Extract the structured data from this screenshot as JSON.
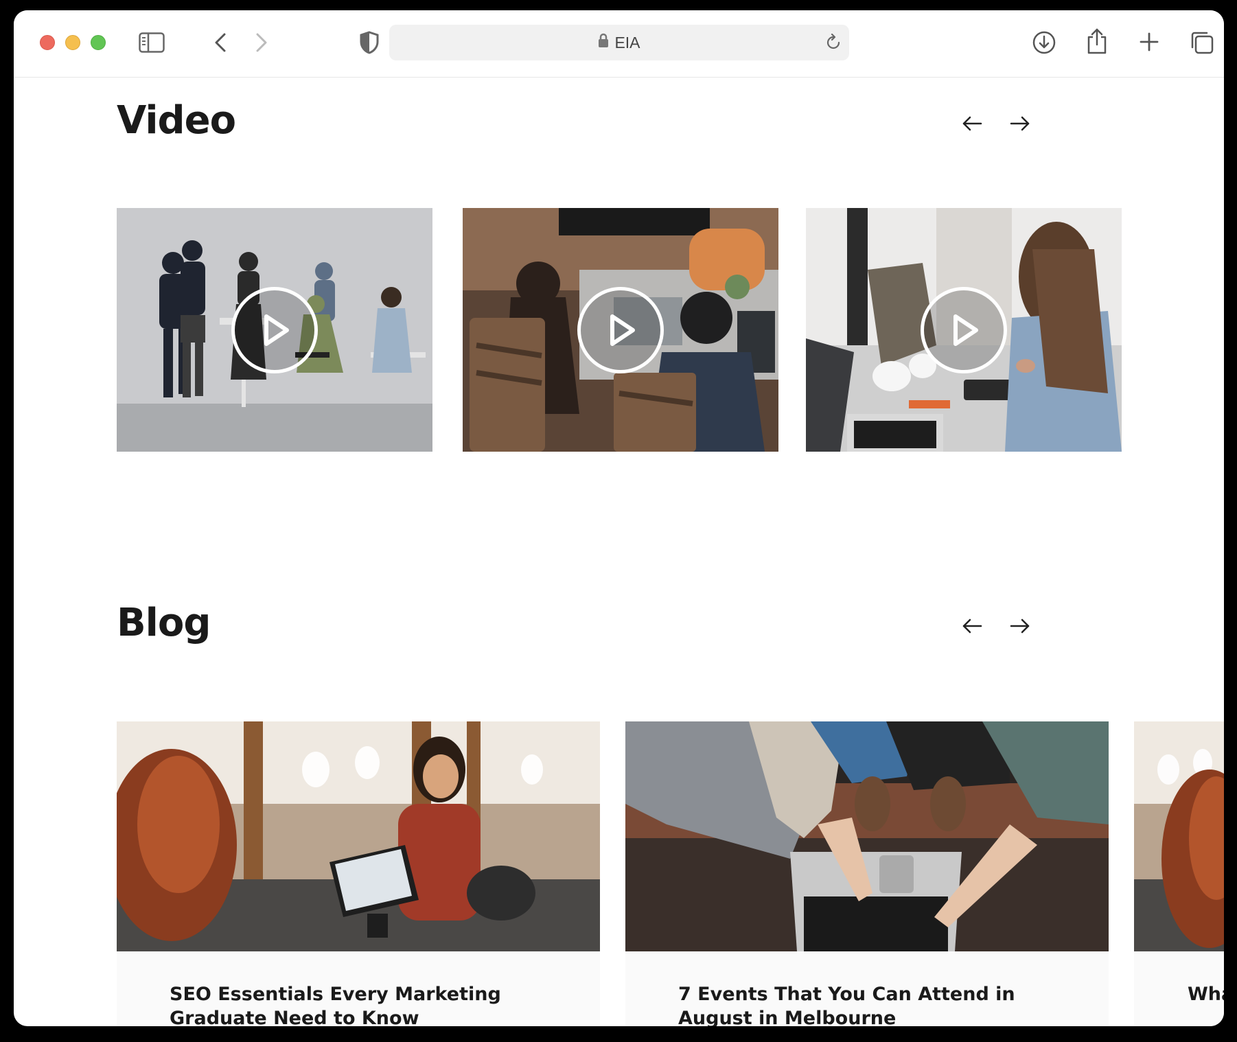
{
  "browser": {
    "url_text": "EIA"
  },
  "video_section": {
    "title": "Video"
  },
  "blog_section": {
    "title": "Blog",
    "posts": [
      {
        "title": "SEO Essentials Every Marketing Graduate Need to Know"
      },
      {
        "title": "7 Events That You Can Attend in August in Melbourne"
      },
      {
        "title": "Wha"
      }
    ]
  },
  "colors": {
    "close": "#ed6a5e",
    "minimize": "#f5bf4f",
    "zoom": "#61c554",
    "heading": "#1a1a1a"
  }
}
